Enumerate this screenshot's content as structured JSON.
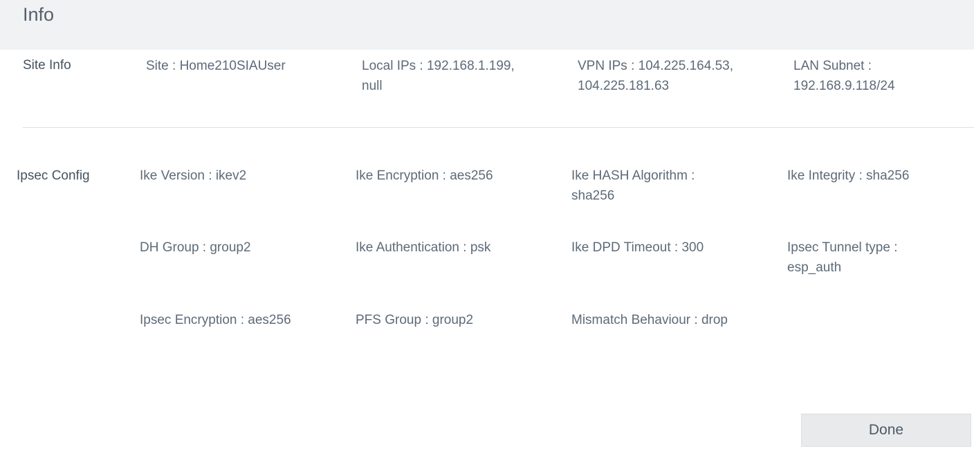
{
  "dialog": {
    "title": "Info"
  },
  "site_info": {
    "label": "Site Info",
    "site": "Site : Home210SIAUser",
    "local_ips_line1": "Local IPs : 192.168.1.199,",
    "local_ips_line2": "null",
    "vpn_ips_line1": "VPN IPs : 104.225.164.53,",
    "vpn_ips_line2": "104.225.181.63",
    "lan_subnet_line1": "LAN Subnet :",
    "lan_subnet_line2": "192.168.9.118/24"
  },
  "ipsec_config": {
    "label": "Ipsec Config",
    "ike_version": "Ike Version : ikev2",
    "ike_encryption": "Ike Encryption : aes256",
    "ike_hash_line1": "Ike HASH Algorithm :",
    "ike_hash_line2": "sha256",
    "ike_integrity": "Ike Integrity : sha256",
    "dh_group": "DH Group : group2",
    "ike_authentication": "Ike Authentication : psk",
    "ike_dpd_timeout": "Ike DPD Timeout : 300",
    "ipsec_tunnel_type_line1": "Ipsec Tunnel type :",
    "ipsec_tunnel_type_line2": "esp_auth",
    "ipsec_encryption": "Ipsec Encryption : aes256",
    "pfs_group": "PFS Group : group2",
    "mismatch_behaviour": "Mismatch Behaviour : drop"
  },
  "footer": {
    "done_label": "Done"
  }
}
